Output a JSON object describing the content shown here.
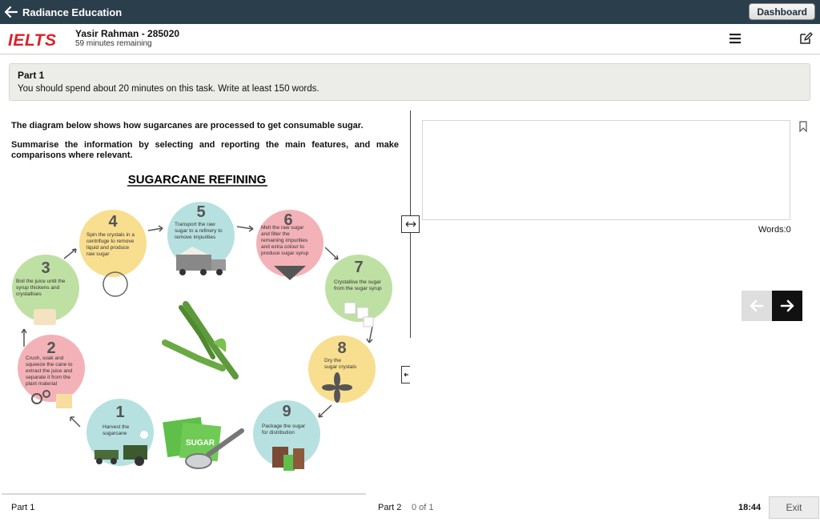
{
  "topbar": {
    "title": "Radiance Education",
    "dashboard_label": "Dashboard"
  },
  "header": {
    "logo": "IELTS",
    "candidate": "Yasir Rahman - 285020",
    "time_remaining": "59 minutes remaining"
  },
  "banner": {
    "title": "Part 1",
    "text": "You should spend about 20 minutes on this task. Write at least 150 words."
  },
  "task": {
    "line1": "The diagram below shows how sugarcanes are processed to get consumable sugar.",
    "line2": "Summarise the information by selecting and reporting the main features, and make comparisons where relevant."
  },
  "diagram": {
    "title": "SUGARCANE REFINING",
    "sugar_label": "SUGAR",
    "steps": [
      {
        "num": "1",
        "lines": [
          "Harvest the",
          "sugarcane"
        ],
        "color": "#b6e1e0"
      },
      {
        "num": "2",
        "lines": [
          "Crush, soak and",
          "squeeze the cane to",
          "extract the juice and",
          "separate it from the",
          "plant material"
        ],
        "color": "#f3b2b7"
      },
      {
        "num": "3",
        "lines": [
          "Boil the juice until the",
          "syrup thickens and",
          "crystallises"
        ],
        "color": "#bfe0a3"
      },
      {
        "num": "4",
        "lines": [
          "Spin the crystals in a",
          "centrifuge to remove",
          "liquid and produce",
          "raw sugar"
        ],
        "color": "#f8de8f"
      },
      {
        "num": "5",
        "lines": [
          "Transport the raw",
          "sugar to a refinery to",
          "remove impurities"
        ],
        "color": "#b6e1e0"
      },
      {
        "num": "6",
        "lines": [
          "Melt the raw sugar",
          "and filter the",
          "remaining impurities",
          "and extra colour to",
          "produce sugar syrup"
        ],
        "color": "#f3b2b7"
      },
      {
        "num": "7",
        "lines": [
          "Crystallise the sugar",
          "from the sugar syrup"
        ],
        "color": "#bfe0a3"
      },
      {
        "num": "8",
        "lines": [
          "Dry the",
          "sugar crystals"
        ],
        "color": "#f8de8f"
      },
      {
        "num": "9",
        "lines": [
          "Package the sugar",
          "for distribution"
        ],
        "color": "#b6e1e0"
      }
    ]
  },
  "answer": {
    "placeholder": "",
    "word_count": "Words:0"
  },
  "footer": {
    "part1": "Part 1",
    "part2": "Part 2",
    "progress": "0 of 1",
    "clock": "18:44",
    "exit_label": "Exit"
  },
  "colors": {
    "topbar": "#2b3e4c",
    "logo": "#d8232a"
  }
}
